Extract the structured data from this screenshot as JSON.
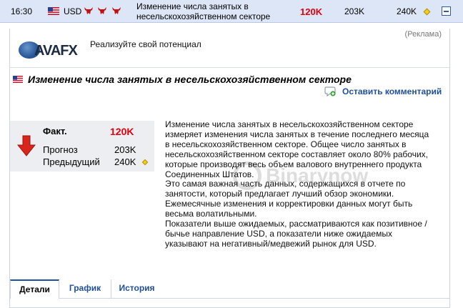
{
  "event_row": {
    "time": "16:30",
    "currency": "USD",
    "importance_icons": [
      "bull-icon",
      "bull-icon",
      "bull-icon"
    ],
    "title": "Изменение числа занятых в несельскохозяйственном секторе",
    "actual": "120K",
    "forecast": "203K",
    "previous": "240K",
    "colors": {
      "row_bg": "#dde6f6",
      "actual": "#e0000e",
      "bull": "#c41010"
    }
  },
  "ad": {
    "logo_text": "AVAFX",
    "text": "Реализуйте свой потенциал",
    "label": "(Реклама)"
  },
  "detail": {
    "headline": "Изменение числа занятых в несельскохозяйственном секторе",
    "comment_link": "Оставить комментарий",
    "stats": {
      "actual_label": "Факт.",
      "actual_value": "120K",
      "forecast_label": "Прогноз",
      "forecast_value": "203K",
      "previous_label": "Предыдущий",
      "previous_value": "240K"
    },
    "description": [
      "Изменение числа занятых в несельскохозяйственном секторе измеряет изменения числа занятых в течение последнего месяца в несельскохозяйственном секторе. Общее число занятых в несельскохозяйственном секторе составляет около 80% рабочих, которые производят весь объем валового внутреннего продукта Соединенных Штатов.",
      "Это самая важная часть данных, содержащихся в отчете по занятости, который предлагает лучший обзор экономики.",
      "Ежемесячные изменения и корректировки данных могут быть весьма волатильными.",
      "Показатели выше ожидаемых, рассматриваются как позитивное / бычье направление USD, а показатели ниже ожидаемых указывают на негативный/медвежий рынок для USD."
    ],
    "watermark": "Binarynow",
    "tabs": [
      {
        "label": "Детали",
        "active": true
      },
      {
        "label": "График",
        "active": false
      },
      {
        "label": "История",
        "active": false
      }
    ],
    "colors": {
      "link": "#1f4f9c",
      "actual": "#e0000e",
      "arrow": "#d8261c"
    }
  }
}
